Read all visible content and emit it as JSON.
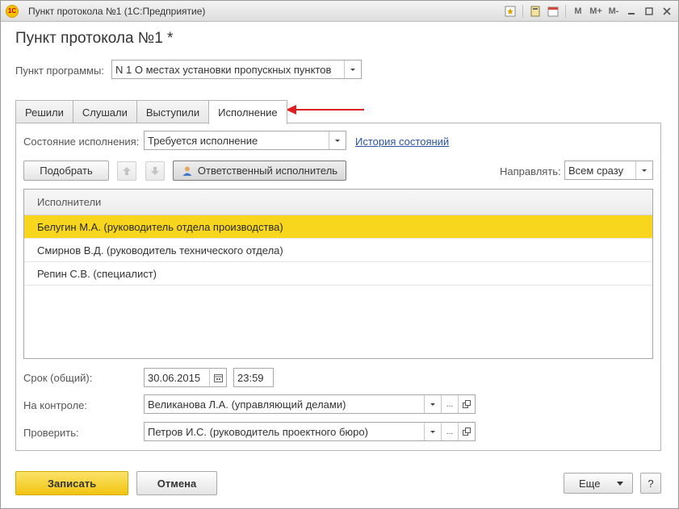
{
  "window": {
    "title": "Пункт протокола №1  (1С:Предприятие)",
    "toolbar_text_buttons": [
      "M",
      "M+",
      "M-"
    ]
  },
  "page": {
    "title": "Пункт протокола №1 *"
  },
  "program_item": {
    "label": "Пункт программы:",
    "value": "N 1 О местах установки пропускных пунктов"
  },
  "tabs": [
    {
      "label": "Решили",
      "active": false
    },
    {
      "label": "Слушали",
      "active": false
    },
    {
      "label": "Выступили",
      "active": false
    },
    {
      "label": "Исполнение",
      "active": true
    }
  ],
  "execution": {
    "state_label": "Состояние исполнения:",
    "state_value": "Требуется исполнение",
    "history_link": "История состояний",
    "pick_button": "Подобрать",
    "responsible_button": "Ответственный исполнитель",
    "direct_label": "Направлять:",
    "direct_value": "Всем сразу"
  },
  "executors": {
    "header": "Исполнители",
    "rows": [
      {
        "text": "Белугин М.А. (руководитель отдела производства)",
        "selected": true
      },
      {
        "text": "Смирнов В.Д. (руководитель технического отдела)",
        "selected": false
      },
      {
        "text": "Репин С.В. (специалист)",
        "selected": false
      }
    ]
  },
  "deadline": {
    "label": "Срок (общий):",
    "date": "30.06.2015",
    "time": "23:59"
  },
  "control": {
    "label": "На контроле:",
    "value": "Великанова Л.А. (управляющий делами)"
  },
  "check": {
    "label": "Проверить:",
    "value": "Петров И.С. (руководитель проектного бюро)"
  },
  "footer": {
    "save": "Записать",
    "cancel": "Отмена",
    "more": "Еще",
    "help": "?"
  },
  "colors": {
    "selected_row": "#f9d61e",
    "primary_button": "#f2c411",
    "link": "#2b55a3",
    "annotation_arrow": "#e02020"
  }
}
